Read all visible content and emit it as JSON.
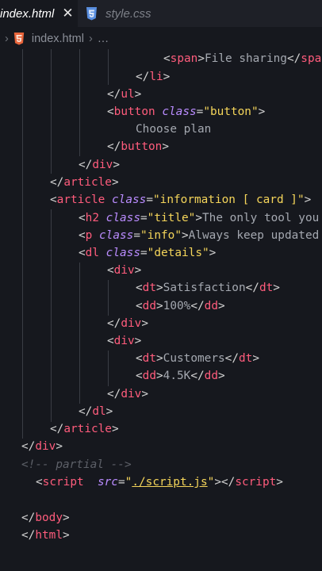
{
  "tabs": [
    {
      "label": "index.html",
      "active": true,
      "close": "✕"
    },
    {
      "label": "style.css",
      "active": false
    }
  ],
  "breadcrumb": {
    "file": "index.html",
    "rest": "…"
  },
  "colors": {
    "tag": "#ff5c7c",
    "attribute": "#ba8cff",
    "string": "#f5d55a",
    "text": "#a4a8b0",
    "comment": "#5d6068",
    "background": "#16181e"
  },
  "code": {
    "l1": {
      "open": "<",
      "tag": "span",
      "close": ">",
      "text": "File sharing",
      "etag_open": "</",
      "etag": "spa"
    },
    "l2": {
      "open": "</",
      "tag": "li",
      "close": ">"
    },
    "l3": {
      "open": "</",
      "tag": "ul",
      "close": ">"
    },
    "l4": {
      "open": "<",
      "tag": "button",
      "attr": "class",
      "eq": "=",
      "val": "\"button\"",
      "close": ">"
    },
    "l5": {
      "text": "Choose plan"
    },
    "l6": {
      "open": "</",
      "tag": "button",
      "close": ">"
    },
    "l7": {
      "open": "</",
      "tag": "div",
      "close": ">"
    },
    "l8": {
      "open": "</",
      "tag": "article",
      "close": ">"
    },
    "l9": {
      "open": "<",
      "tag": "article",
      "attr": "class",
      "eq": "=",
      "val": "\"information [ card ]\"",
      "close": ">"
    },
    "l10": {
      "open": "<",
      "tag": "h2",
      "attr": "class",
      "eq": "=",
      "val": "\"title\"",
      "close": ">",
      "text": "The only tool you"
    },
    "l11": {
      "open": "<",
      "tag": "p",
      "attr": "class",
      "eq": "=",
      "val": "\"info\"",
      "close": ">",
      "text": "Always keep updated"
    },
    "l12": {
      "open": "<",
      "tag": "dl",
      "attr": "class",
      "eq": "=",
      "val": "\"details\"",
      "close": ">"
    },
    "l13": {
      "open": "<",
      "tag": "div",
      "close": ">"
    },
    "l14": {
      "open": "<",
      "tag": "dt",
      "close": ">",
      "text": "Satisfaction",
      "etag_open": "</",
      "etag": "dt",
      "etag_close": ">"
    },
    "l15": {
      "open": "<",
      "tag": "dd",
      "close": ">",
      "text": "100%",
      "etag_open": "</",
      "etag": "dd",
      "etag_close": ">"
    },
    "l16": {
      "open": "</",
      "tag": "div",
      "close": ">"
    },
    "l17": {
      "open": "<",
      "tag": "div",
      "close": ">"
    },
    "l18": {
      "open": "<",
      "tag": "dt",
      "close": ">",
      "text": "Customers",
      "etag_open": "</",
      "etag": "dt",
      "etag_close": ">"
    },
    "l19": {
      "open": "<",
      "tag": "dd",
      "close": ">",
      "text": "4.5K",
      "etag_open": "</",
      "etag": "dd",
      "etag_close": ">"
    },
    "l20": {
      "open": "</",
      "tag": "div",
      "close": ">"
    },
    "l21": {
      "open": "</",
      "tag": "dl",
      "close": ">"
    },
    "l22": {
      "open": "</",
      "tag": "article",
      "close": ">"
    },
    "l23": {
      "open": "</",
      "tag": "div",
      "close": ">"
    },
    "l24": {
      "comment": "<!-- partial -->"
    },
    "l25": {
      "open": "<",
      "tag": "script",
      "attr": "src",
      "eq": "=",
      "q1": "\"",
      "val": "./script.js",
      "q2": "\"",
      "close": ">",
      "etag_open": "</",
      "etag": "script",
      "etag_close": ">"
    },
    "l27": {
      "open": "</",
      "tag": "body",
      "close": ">"
    },
    "l28": {
      "open": "</",
      "tag": "html",
      "close": ">"
    }
  }
}
